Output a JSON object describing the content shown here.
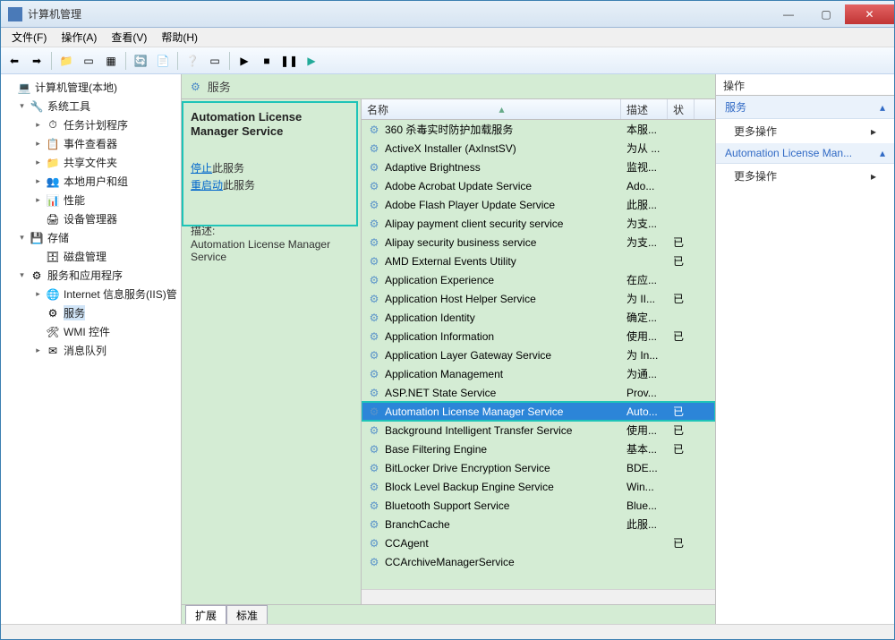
{
  "window": {
    "title": "计算机管理"
  },
  "menubar": [
    "文件(F)",
    "操作(A)",
    "查看(V)",
    "帮助(H)"
  ],
  "tree": [
    {
      "level": 1,
      "toggle": "",
      "icon": "💻",
      "label": "计算机管理(本地)"
    },
    {
      "level": 2,
      "toggle": "▾",
      "icon": "🔧",
      "label": "系统工具"
    },
    {
      "level": 3,
      "toggle": "▸",
      "icon": "⏱",
      "label": "任务计划程序"
    },
    {
      "level": 3,
      "toggle": "▸",
      "icon": "📋",
      "label": "事件查看器"
    },
    {
      "level": 3,
      "toggle": "▸",
      "icon": "📁",
      "label": "共享文件夹"
    },
    {
      "level": 3,
      "toggle": "▸",
      "icon": "👥",
      "label": "本地用户和组"
    },
    {
      "level": 3,
      "toggle": "▸",
      "icon": "📊",
      "label": "性能"
    },
    {
      "level": 3,
      "toggle": "",
      "icon": "🖨",
      "label": "设备管理器"
    },
    {
      "level": 2,
      "toggle": "▾",
      "icon": "💾",
      "label": "存储"
    },
    {
      "level": 3,
      "toggle": "",
      "icon": "🗄",
      "label": "磁盘管理"
    },
    {
      "level": 2,
      "toggle": "▾",
      "icon": "⚙",
      "label": "服务和应用程序"
    },
    {
      "level": 3,
      "toggle": "▸",
      "icon": "🌐",
      "label": "Internet 信息服务(IIS)管"
    },
    {
      "level": 3,
      "toggle": "",
      "icon": "⚙",
      "label": "服务",
      "selected": true
    },
    {
      "level": 3,
      "toggle": "",
      "icon": "🛠",
      "label": "WMI 控件"
    },
    {
      "level": 3,
      "toggle": "▸",
      "icon": "✉",
      "label": "消息队列"
    }
  ],
  "center": {
    "title": "服务",
    "detail": {
      "title": "Automation License Manager Service",
      "stop_link": "停止",
      "stop_suffix": "此服务",
      "restart_link": "重启动",
      "restart_suffix": "此服务",
      "desc_label": "描述:",
      "desc_text": "Automation License Manager Service"
    },
    "columns": {
      "name": "名称",
      "desc": "描述",
      "status": "状"
    },
    "rows": [
      {
        "name": "360 杀毒实时防护加载服务",
        "desc": "本服...",
        "status": ""
      },
      {
        "name": "ActiveX Installer (AxInstSV)",
        "desc": "为从 ...",
        "status": ""
      },
      {
        "name": "Adaptive Brightness",
        "desc": "监视...",
        "status": ""
      },
      {
        "name": "Adobe Acrobat Update Service",
        "desc": "Ado...",
        "status": ""
      },
      {
        "name": "Adobe Flash Player Update Service",
        "desc": "此服...",
        "status": ""
      },
      {
        "name": "Alipay payment client security service",
        "desc": "为支...",
        "status": ""
      },
      {
        "name": "Alipay security business service",
        "desc": "为支...",
        "status": "已"
      },
      {
        "name": "AMD External Events Utility",
        "desc": "",
        "status": "已"
      },
      {
        "name": "Application Experience",
        "desc": "在应...",
        "status": ""
      },
      {
        "name": "Application Host Helper Service",
        "desc": "为 II...",
        "status": "已"
      },
      {
        "name": "Application Identity",
        "desc": "确定...",
        "status": ""
      },
      {
        "name": "Application Information",
        "desc": "使用...",
        "status": "已"
      },
      {
        "name": "Application Layer Gateway Service",
        "desc": "为 In...",
        "status": ""
      },
      {
        "name": "Application Management",
        "desc": "为通...",
        "status": ""
      },
      {
        "name": "ASP.NET State Service",
        "desc": "Prov...",
        "status": ""
      },
      {
        "name": "Automation License Manager Service",
        "desc": "Auto...",
        "status": "已",
        "selected": true
      },
      {
        "name": "Background Intelligent Transfer Service",
        "desc": "使用...",
        "status": "已"
      },
      {
        "name": "Base Filtering Engine",
        "desc": "基本...",
        "status": "已"
      },
      {
        "name": "BitLocker Drive Encryption Service",
        "desc": "BDE...",
        "status": ""
      },
      {
        "name": "Block Level Backup Engine Service",
        "desc": "Win...",
        "status": ""
      },
      {
        "name": "Bluetooth Support Service",
        "desc": "Blue...",
        "status": ""
      },
      {
        "name": "BranchCache",
        "desc": "此服...",
        "status": ""
      },
      {
        "name": "CCAgent",
        "desc": "",
        "status": "已"
      },
      {
        "name": "CCArchiveManagerService",
        "desc": "",
        "status": ""
      }
    ],
    "tabs": {
      "extended": "扩展",
      "standard": "标准"
    }
  },
  "right": {
    "header": "操作",
    "group1": "服务",
    "more1": "更多操作",
    "group2": "Automation License Man...",
    "more2": "更多操作"
  }
}
